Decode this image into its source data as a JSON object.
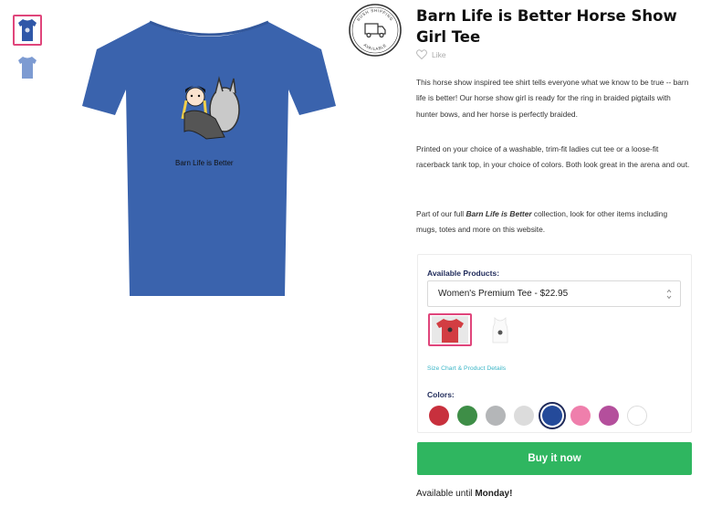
{
  "product": {
    "title": "Barn Life is Better Horse Show Girl Tee",
    "like_label": "Like",
    "shirt_text": "Barn Life is Better"
  },
  "badge": {
    "top_text": "RUSH SHIPPING",
    "bottom_text": "AVAILABLE"
  },
  "description": {
    "p1": "This horse show inspired tee shirt tells everyone what we know to be true -- barn life is better! Our horse show girl is ready for the ring in braided pigtails with hunter bows, and her horse is perfectly braided.",
    "p2": "Printed on your choice of a washable, trim-fit ladies cut tee or a loose-fit racerback tank top, in your choice of colors. Both look great in the arena and out.",
    "p3_before": "Part of our full ",
    "p3_bold": "Barn Life is Better",
    "p3_after": " collection, look for other items including mugs, totes and more on this website."
  },
  "options": {
    "products_label": "Available Products:",
    "selected_product": "Women's Premium Tee - $22.95",
    "size_chart_link": "Size Chart & Product Details",
    "colors_label": "Colors:",
    "colors": [
      "#c8303d",
      "#3e8e47",
      "#b4b6b8",
      "#dcdcdc",
      "#244a9a",
      "#ef7fac",
      "#b44f9c",
      "#ffffff"
    ],
    "selected_color_index": 4
  },
  "buy_button_label": "Buy it now",
  "availability": {
    "prefix": "Available until ",
    "day": "Monday!"
  },
  "theme": {
    "accent": "#e0457b",
    "buy_green": "#2fb660",
    "shirt_blue": "#3a63ad",
    "link_teal": "#3cb6c7"
  }
}
